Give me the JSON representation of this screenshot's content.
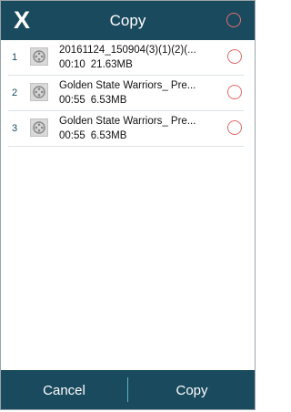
{
  "header": {
    "close_label": "X",
    "title": "Copy"
  },
  "items": [
    {
      "index": "1",
      "title": "20161124_150904(3)(1)(2)(...",
      "duration": "00:10",
      "size": "21.63MB"
    },
    {
      "index": "2",
      "title": "Golden State Warriors_ Pre...",
      "duration": "00:55",
      "size": "6.53MB"
    },
    {
      "index": "3",
      "title": "Golden State Warriors_ Pre...",
      "duration": "00:55",
      "size": "6.53MB"
    }
  ],
  "footer": {
    "cancel_label": "Cancel",
    "copy_label": "Copy"
  },
  "colors": {
    "bar": "#1a4a5e",
    "radio_border": "#e06a6a",
    "divider": "#5fb3c5"
  },
  "icons": {
    "thumbnail": "film-reel-icon",
    "select": "radio-unchecked-icon"
  }
}
